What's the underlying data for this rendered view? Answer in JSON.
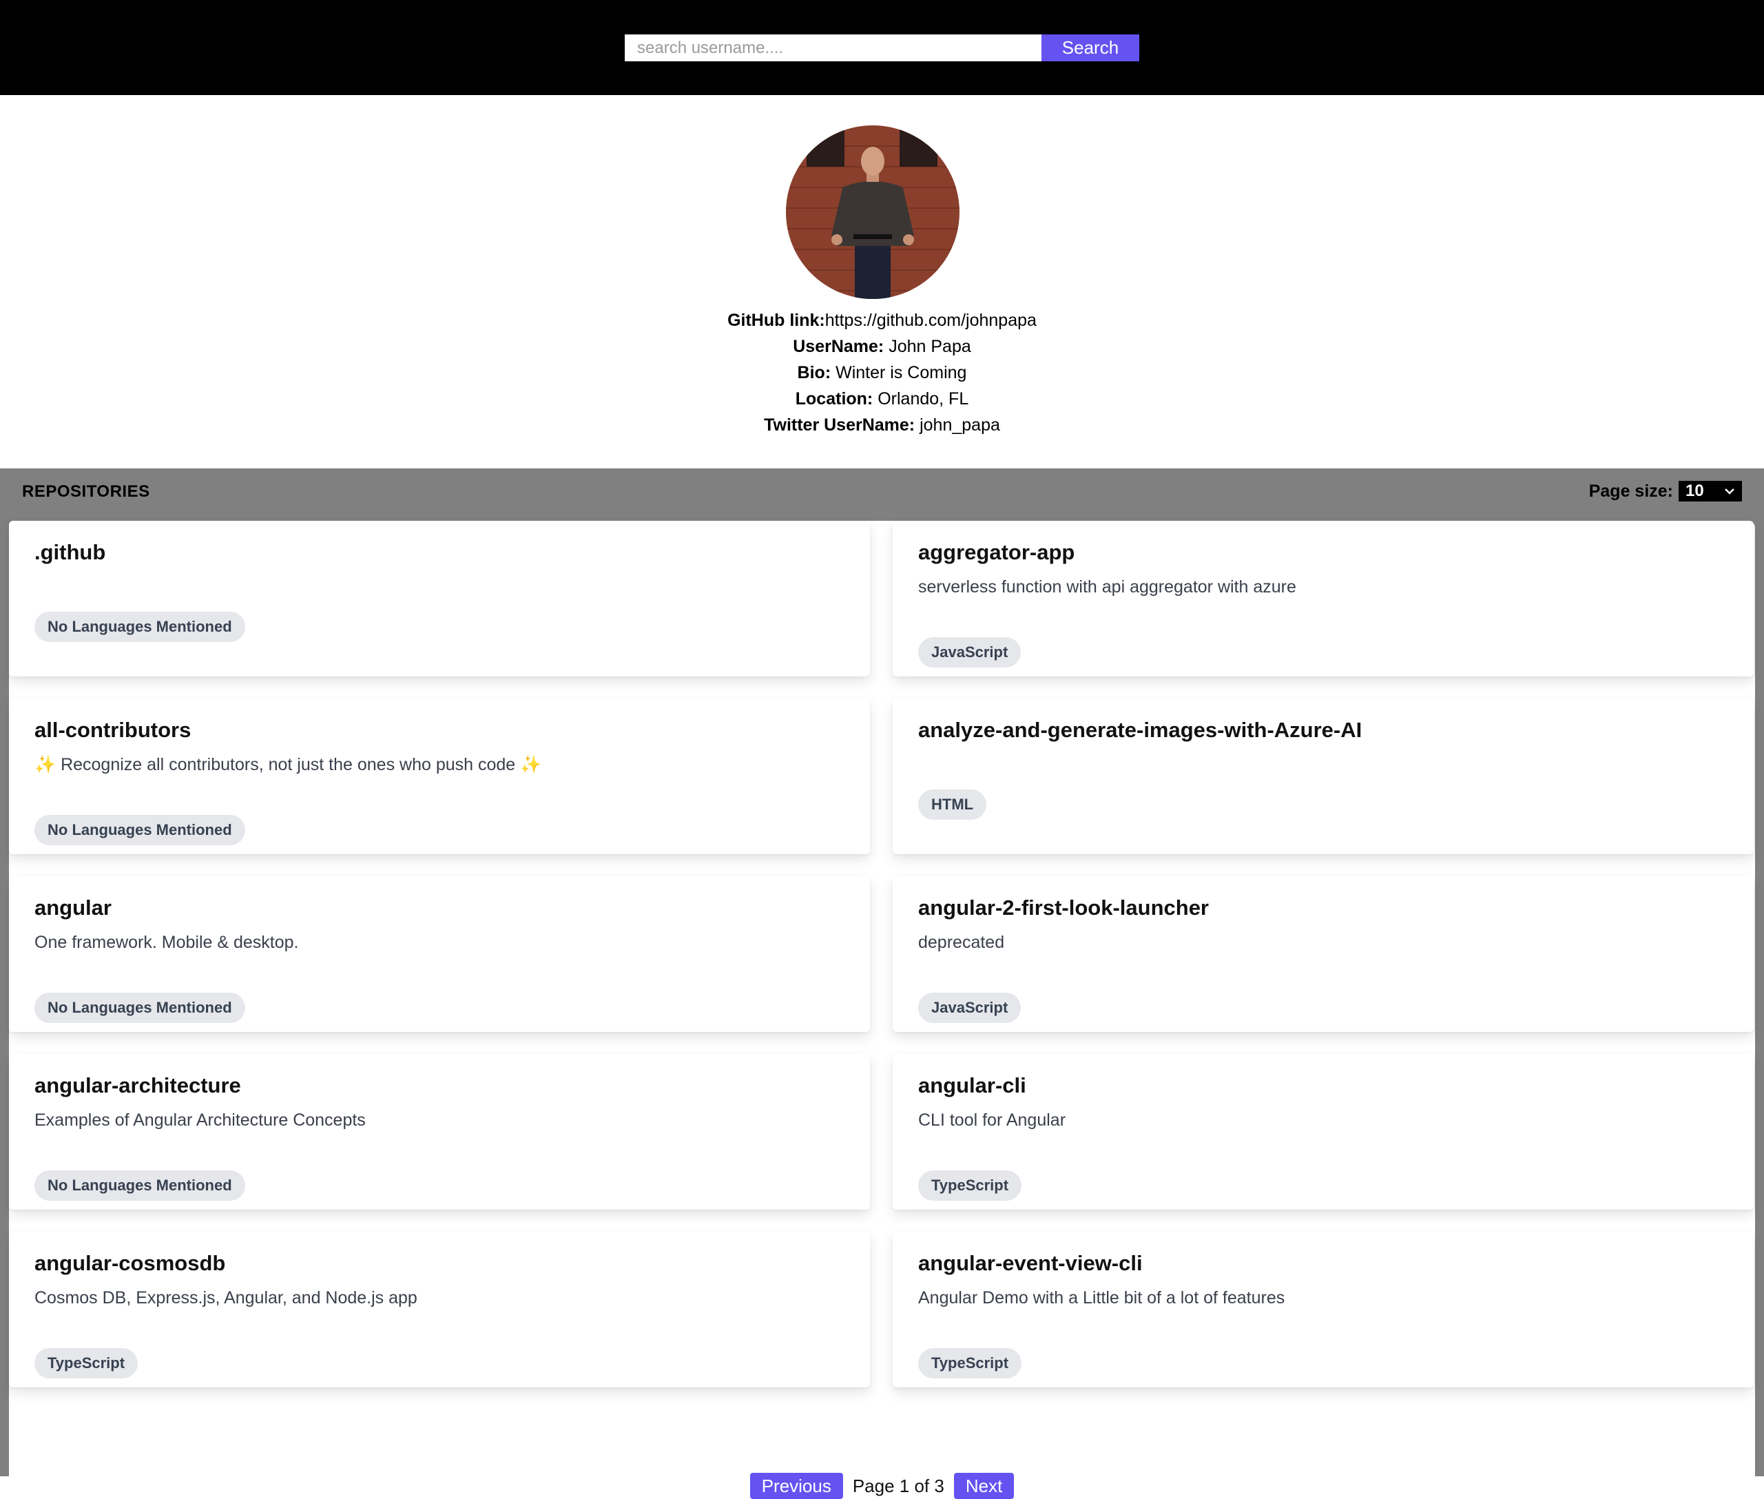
{
  "header": {
    "search_placeholder": "search username....",
    "search_value": "",
    "search_button": "Search"
  },
  "profile": {
    "github_label": "GitHub link:",
    "github_value": "https://github.com/johnpapa",
    "username_label": "UserName:",
    "username_value": "John Papa",
    "bio_label": "Bio:",
    "bio_value": "Winter is Coming",
    "location_label": "Location:",
    "location_value": "Orlando, FL",
    "twitter_label": "Twitter UserName:",
    "twitter_value": "john_papa"
  },
  "repos": {
    "title": "REPOSITORIES",
    "page_size_label": "Page size:",
    "page_size_value": "10",
    "items": [
      {
        "name": ".github",
        "description": "",
        "language": "No Languages Mentioned"
      },
      {
        "name": "aggregator-app",
        "description": "serverless function with api aggregator with azure",
        "language": "JavaScript"
      },
      {
        "name": "all-contributors",
        "description": "✨ Recognize all contributors, not just the ones who push code ✨",
        "language": "No Languages Mentioned"
      },
      {
        "name": "analyze-and-generate-images-with-Azure-AI",
        "description": "",
        "language": "HTML"
      },
      {
        "name": "angular",
        "description": "One framework. Mobile & desktop.",
        "language": "No Languages Mentioned"
      },
      {
        "name": "angular-2-first-look-launcher",
        "description": "deprecated",
        "language": "JavaScript"
      },
      {
        "name": "angular-architecture",
        "description": "Examples of Angular Architecture Concepts",
        "language": "No Languages Mentioned"
      },
      {
        "name": "angular-cli",
        "description": "CLI tool for Angular",
        "language": "TypeScript"
      },
      {
        "name": "angular-cosmosdb",
        "description": "Cosmos DB, Express.js, Angular, and Node.js app",
        "language": "TypeScript"
      },
      {
        "name": "angular-event-view-cli",
        "description": "Angular Demo with a Little bit of a lot of features",
        "language": "TypeScript"
      }
    ]
  },
  "pagination": {
    "previous": "Previous",
    "status": "Page 1 of 3",
    "next": "Next"
  },
  "colors": {
    "accent": "#6453f0",
    "topbar": "#000000",
    "repos_bg": "#808080",
    "badge_bg": "#e5e7eb"
  }
}
